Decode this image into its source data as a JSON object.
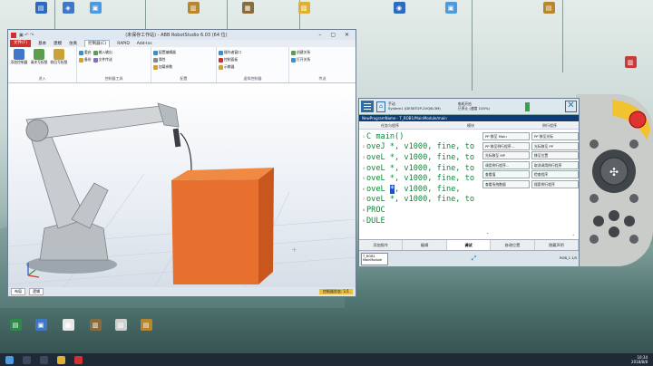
{
  "desktop": {
    "top_icons": [
      {
        "label": "",
        "color": "#2e6bbf",
        "glyph": "▤"
      },
      {
        "label": "",
        "color": "#3f78c8",
        "glyph": "◈"
      },
      {
        "label": "",
        "color": "#4c9be0",
        "glyph": "▣"
      },
      {
        "label": "",
        "color": "#b8862d",
        "glyph": "▥"
      },
      {
        "label": "",
        "color": "#8a6b3c",
        "glyph": "▦"
      },
      {
        "label": "",
        "color": "#e0b030",
        "glyph": "▧"
      }
    ],
    "right_icons": [
      {
        "label": "",
        "color": "#2e6bbf",
        "glyph": "◉"
      },
      {
        "label": "",
        "color": "#4c9be0",
        "glyph": "▣"
      },
      {
        "label": "",
        "color": "#b8862d",
        "glyph": "▤"
      },
      {
        "label": "",
        "color": "#c93a3a",
        "glyph": "▥"
      }
    ],
    "bottom_icons": [
      {
        "label": "",
        "color": "#2e8a47",
        "glyph": "▤"
      },
      {
        "label": "",
        "color": "#3f78c8",
        "glyph": "▣"
      },
      {
        "label": "",
        "color": "#e8e8e8",
        "glyph": "▦"
      },
      {
        "label": "",
        "color": "#8a6b3c",
        "glyph": "▥"
      },
      {
        "label": "",
        "color": "#d0d0d0",
        "glyph": "▧"
      },
      {
        "label": "",
        "color": "#b8862d",
        "glyph": "▤"
      }
    ]
  },
  "robotstudio": {
    "title": "(未保存工作站) - ABB RobotStudio 6.03 (64 位)",
    "tabs": [
      "文件(F)",
      "基本",
      "建模",
      "仿真",
      "控制器(C)",
      "RAPID",
      "Add-Ins"
    ],
    "active_tab": "控制器(C)",
    "groups": [
      {
        "label": "进入",
        "buttons": [
          "添加控制器",
          "请求写权限",
          "收回写权限"
        ]
      },
      {
        "label": "控制器工具",
        "small": [
          "重启",
          "备份",
          "输入输出",
          "文件传送"
        ]
      },
      {
        "label": "配置",
        "small": [
          "配置编辑器",
          "属性",
          "加载参数"
        ]
      },
      {
        "label": "虚拟控制器",
        "small": [
          "操作者窗口",
          "控制面板",
          "示教器"
        ]
      },
      {
        "label": "传送",
        "small": [
          "创建关系",
          "打开关系"
        ]
      }
    ],
    "status": {
      "tab1": "布局",
      "tab2": "逻辑",
      "mode": "控制器状态: 1/1"
    }
  },
  "flexpendant": {
    "header_line1": "手动",
    "header_line2": "System1 (DESKTOP-2VQ6L3M)",
    "header_line3": "电机开启",
    "header_line4": "已停止 (速度 100%)",
    "path": "NewProgramName - T_ROB1/MainModule/main",
    "col_task": "任务与程序",
    "col_module": "模块",
    "col_routine": "例行程序",
    "code_lines": [
      {
        "n": "1",
        "text": "C main()"
      },
      {
        "n": "2",
        "text": "oveJ *, v1000, fine, to"
      },
      {
        "n": "3",
        "text": "oveL *, v1000, fine, to"
      },
      {
        "n": "4",
        "text": "oveL *, v1000, fine, to"
      },
      {
        "n": "5",
        "text": "oveL *, v1000, fine, to"
      },
      {
        "n": "6",
        "text": "oveL ",
        "cursor": "*",
        "after": ", v1000, fine,"
      },
      {
        "n": "7",
        "text": "oveL *, v1000, fine, to"
      },
      {
        "n": "8",
        "text": "PROC"
      },
      {
        "n": "9",
        "text": "DULE"
      }
    ],
    "instructions": [
      "PP 移至 Main",
      "PP 移至光标",
      "PP 移至例行程序...",
      "光标移至 PP",
      "光标移至 MP",
      "移至位置",
      "调用例行程序...",
      "取消调用例行程序",
      "查看值",
      "检查程序",
      "查看系统数据",
      "搜索例行程序"
    ],
    "bottom_tabs": [
      "添加指令",
      "编辑",
      "调试",
      "修改位置",
      "隐藏声明"
    ],
    "selected_tab": "调试",
    "taskbar_item": "T_ROB1 MainModule",
    "indicator": "ROB_1 1/3"
  },
  "taskbar": {
    "time": "10:34",
    "date": "2018/8/8"
  }
}
